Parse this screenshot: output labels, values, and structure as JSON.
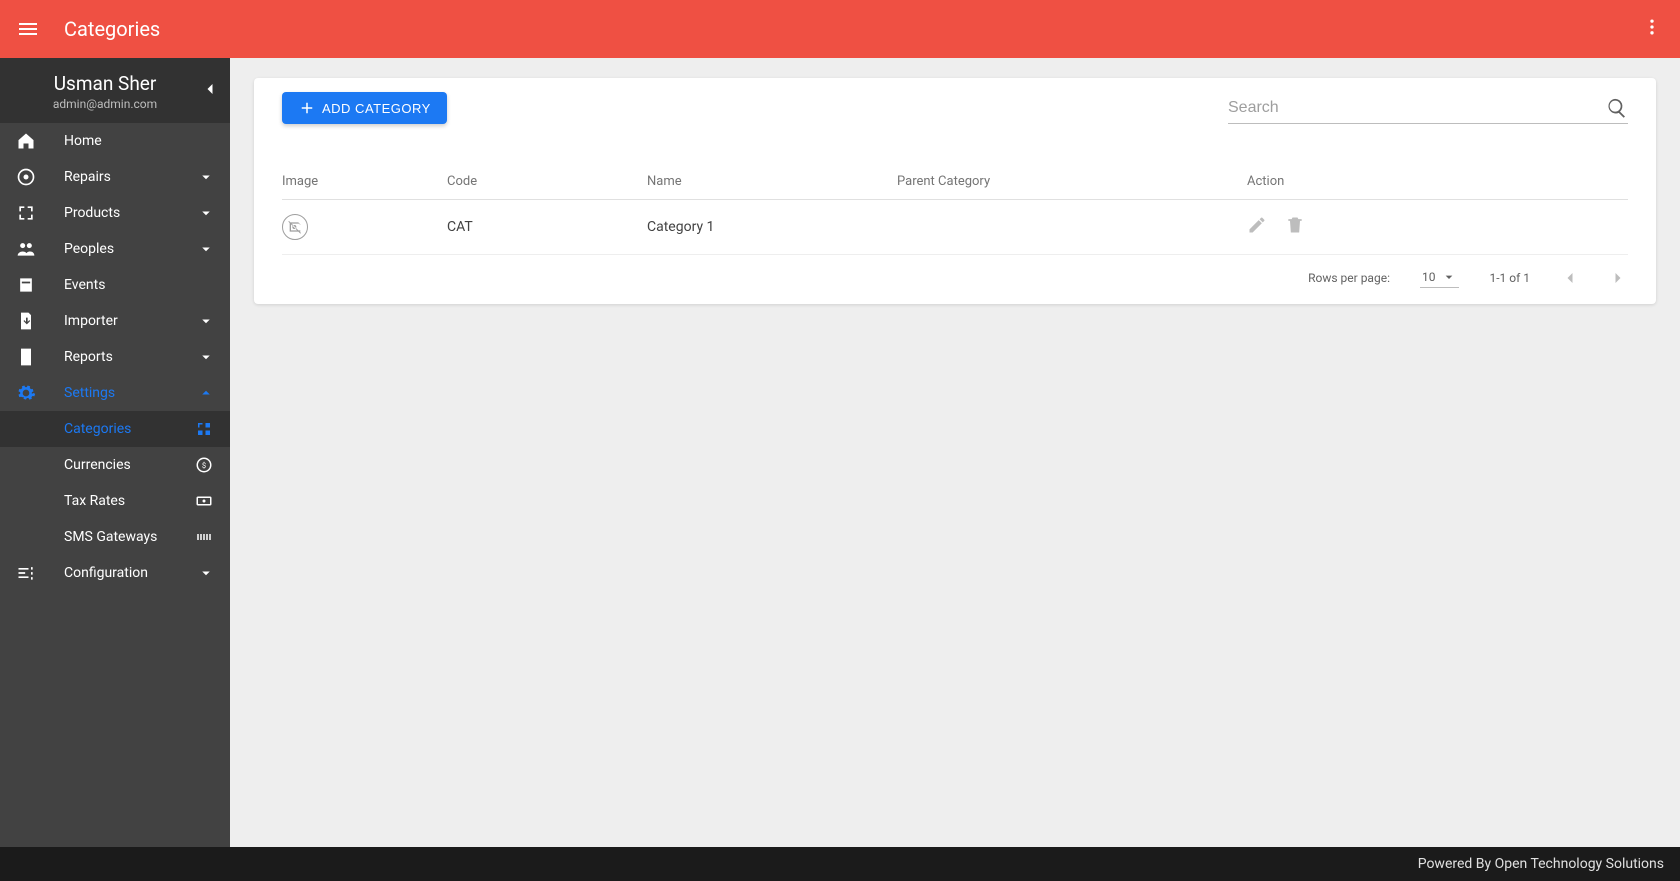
{
  "header": {
    "title": "Categories"
  },
  "user": {
    "name": "Usman Sher",
    "email": "admin@admin.com"
  },
  "sidebar": {
    "items": [
      {
        "label": "Home"
      },
      {
        "label": "Repairs"
      },
      {
        "label": "Products"
      },
      {
        "label": "Peoples"
      },
      {
        "label": "Events"
      },
      {
        "label": "Importer"
      },
      {
        "label": "Reports"
      },
      {
        "label": "Settings"
      },
      {
        "label": "Configuration"
      }
    ],
    "settings_children": [
      {
        "label": "Categories"
      },
      {
        "label": "Currencies"
      },
      {
        "label": "Tax Rates"
      },
      {
        "label": "SMS Gateways"
      }
    ]
  },
  "toolbar": {
    "add_label": "ADD CATEGORY",
    "search_placeholder": "Search"
  },
  "table": {
    "headers": {
      "image": "Image",
      "code": "Code",
      "name": "Name",
      "parent": "Parent Category",
      "action": "Action"
    },
    "rows": [
      {
        "code": "CAT",
        "name": "Category 1",
        "parent": ""
      }
    ]
  },
  "pagination": {
    "rows_label": "Rows per page:",
    "rows_value": "10",
    "range": "1-1 of 1"
  },
  "footer": {
    "text": "Powered By Open Technology Solutions"
  }
}
